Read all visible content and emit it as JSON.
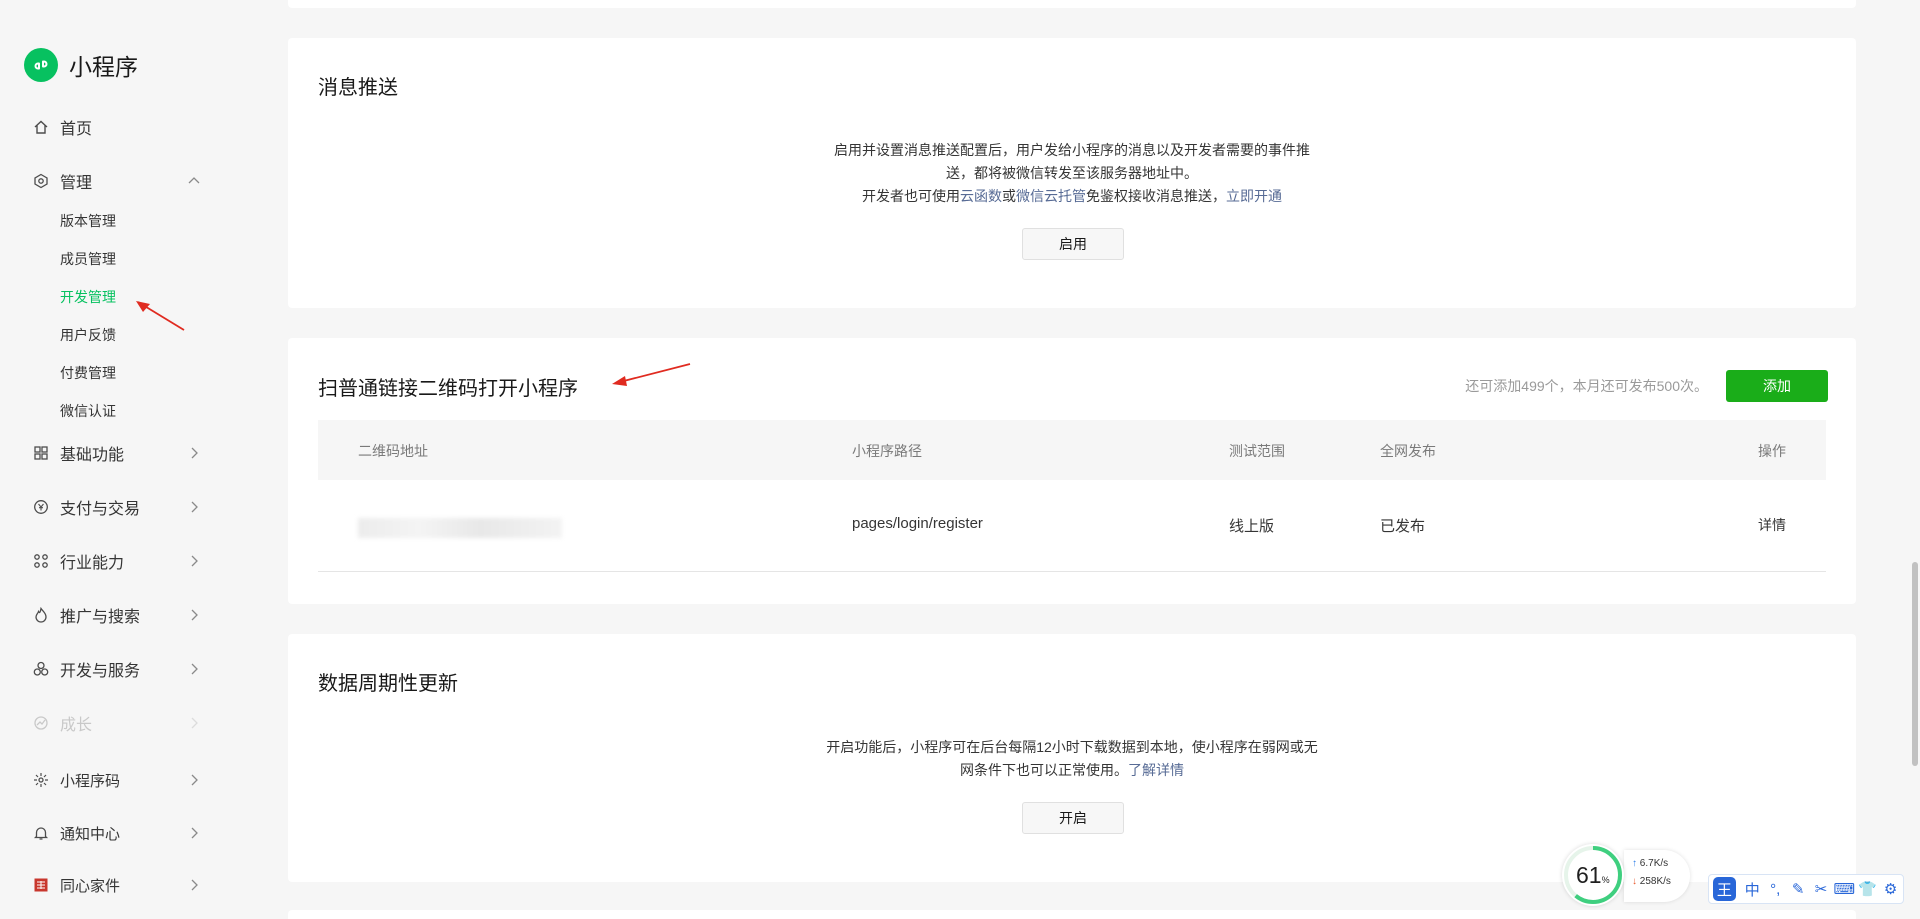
{
  "app": {
    "name": "小程序",
    "brand_color": "#07c160"
  },
  "sidebar": {
    "home": "首页",
    "manage": "管理",
    "sub_items": [
      "版本管理",
      "成员管理",
      "开发管理",
      "用户反馈",
      "付费管理",
      "微信认证"
    ],
    "active_sub": "开发管理",
    "items": [
      "基础功能",
      "支付与交易",
      "行业能力",
      "推广与搜索",
      "开发与服务",
      "成长",
      "小程序码",
      "通知中心",
      "同心家件"
    ]
  },
  "msg_push": {
    "title": "消息推送",
    "desc_line1": "启用并设置消息推送配置后，用户发给小程序的消息以及开发者需要的事件推",
    "desc_line2": "送，都将被微信转发至该服务器地址中。",
    "desc_line3_pre": "开发者也可使用",
    "link_cloud_func": "云函数",
    "or": "或",
    "link_cloud_host": "微信云托管",
    "desc_line3_post": "免鉴权接收消息推送，",
    "link_open": "立即开通",
    "button": "启用"
  },
  "qr": {
    "title": "扫普通链接二维码打开小程序",
    "quota": "还可添加499个，本月还可发布500次。",
    "add_button": "添加",
    "columns": [
      "二维码地址",
      "小程序路径",
      "测试范围",
      "全网发布",
      "操作"
    ],
    "rows": [
      {
        "path": "pages/login/register",
        "scope": "线上版",
        "status": "已发布",
        "action": "详情"
      }
    ]
  },
  "data_update": {
    "title": "数据周期性更新",
    "desc_line1": "开启功能后，小程序可在后台每隔12小时下载数据到本地，使小程序在弱网或无",
    "desc_line2_pre": "网条件下也可以正常使用。",
    "link_more": "了解详情",
    "button": "开启"
  },
  "monitor": {
    "percent": "61",
    "percent_unit": "%",
    "up": "6.7",
    "down": "258",
    "unit": "K/s"
  },
  "ime": {
    "logo": "王",
    "mode": "中"
  }
}
